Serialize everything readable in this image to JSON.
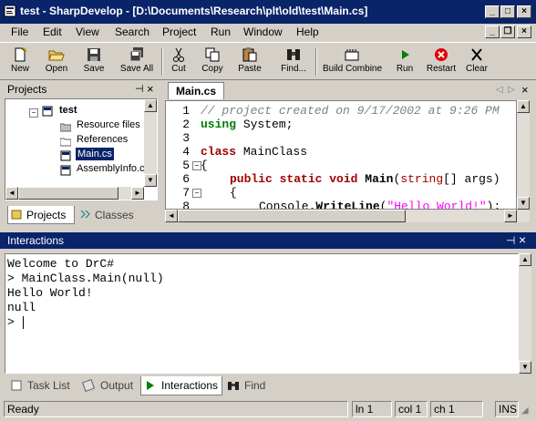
{
  "window": {
    "title": "test - SharpDevelop - [D:\\Documents\\Research\\plt\\old\\test\\Main.cs]"
  },
  "menu": [
    "File",
    "Edit",
    "View",
    "Search",
    "Project",
    "Run",
    "Window",
    "Help"
  ],
  "toolbar": {
    "new": "New",
    "open": "Open",
    "save": "Save",
    "save_all": "Save All",
    "cut": "Cut",
    "copy": "Copy",
    "paste": "Paste",
    "find": "Find...",
    "build": "Build Combine",
    "run": "Run",
    "restart": "Restart",
    "clear": "Clear"
  },
  "projects": {
    "header": "Projects",
    "tree": [
      "test",
      "Resource files",
      "References",
      "Main.cs",
      "AssemblyInfo.c"
    ],
    "tabs": [
      "Projects",
      "Classes"
    ]
  },
  "editor": {
    "tab": "Main.cs",
    "line_numbers": [
      "1",
      "2",
      "3",
      "4",
      "5",
      "6",
      "7",
      "8"
    ],
    "lines": {
      "l1": "// project created on 9/17/2002 at 9:26 PM",
      "l2_kw": "using",
      "l2_rest": " System;",
      "l4_kw": "class",
      "l4_rest": " MainClass",
      "l5": "{",
      "l6_a": "public",
      "l6_b": "static",
      "l6_c": "void",
      "l6_d": "Main",
      "l6_e": "(",
      "l6_f": "string",
      "l6_g": "[] args)",
      "l7": "{",
      "l8_a": "Console.",
      "l8_b": "WriteLine",
      "l8_c": "(",
      "l8_d": "\"Hello World!\"",
      "l8_e": ");"
    }
  },
  "interactions": {
    "header": "Interactions",
    "console": [
      "Welcome to DrC#",
      "> MainClass.Main(null)",
      "Hello World!",
      "null",
      "> "
    ]
  },
  "bottom_tabs": [
    "Task List",
    "Output",
    "Interactions",
    "Find"
  ],
  "status": {
    "ready": "Ready",
    "ln": "ln 1",
    "col": "col 1",
    "ch": "ch 1",
    "ins": "INS"
  },
  "colors": {
    "title_bar": "#0a246a",
    "selection": "#0a246a",
    "comment": "#808080",
    "keyword": "#008000",
    "string": "#ff00ff"
  }
}
